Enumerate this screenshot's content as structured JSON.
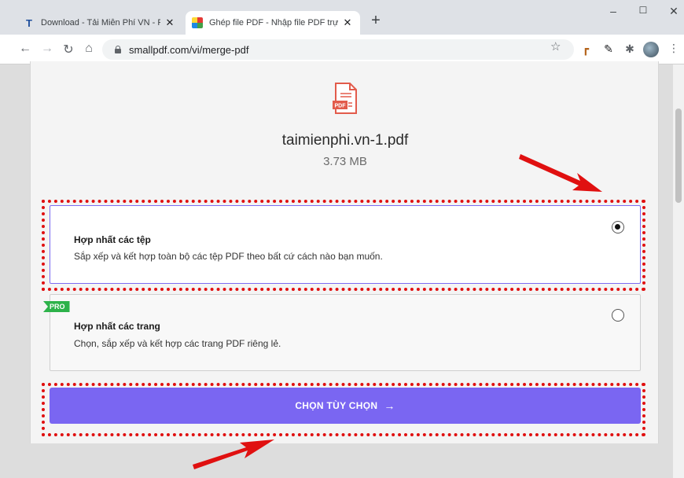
{
  "browser": {
    "tabs": [
      {
        "title": "Download - Tải Miễn Phí VN - Pl",
        "favicon": "t-letter-icon",
        "active": false
      },
      {
        "title": "Ghép file PDF - Nhập file PDF trự",
        "favicon": "smallpdf-icon",
        "active": true
      }
    ],
    "new_tab_label": "+",
    "window_controls": {
      "minimize": "–",
      "maximize": "☐",
      "close": "✕"
    },
    "url": "smallpdf.com/vi/merge-pdf"
  },
  "file": {
    "name": "taimienphi.vn-1.pdf",
    "size": "3.73 MB",
    "icon_label": "PDF"
  },
  "options": [
    {
      "title": "Hợp nhất các tệp",
      "description": "Sắp xếp và kết hợp toàn bộ các tệp PDF theo bất cứ cách nào bạn muốn.",
      "selected": true
    },
    {
      "title": "Hợp nhất các trang",
      "description": "Chọn, sắp xếp và kết hợp các trang PDF riêng lẻ.",
      "selected": false,
      "badge": "PRO"
    }
  ],
  "cta": {
    "label": "CHỌN TÙY CHỌN",
    "arrow": "→"
  },
  "colors": {
    "accent": "#7a66f2",
    "pro_badge": "#2db24a",
    "annotation": "#e01010"
  }
}
